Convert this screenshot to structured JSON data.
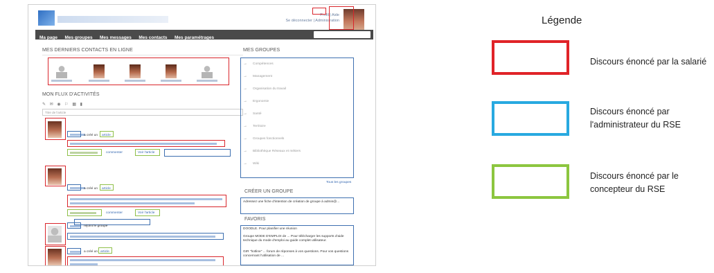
{
  "screenshot": {
    "toplinks_upper": "Profil | Aide",
    "toplinks_lower": "Se déconnecter | Administration",
    "nav": [
      "Ma page",
      "Mes groupes",
      "Mes messages",
      "Mes contacts",
      "Mes paramétrages"
    ],
    "contacts_heading": "MES DERNIERS CONTACTS EN LIGNE",
    "activity_heading": "MON FLUX D'ACTIVITÉS",
    "title_placeholder": "Titre de l'article",
    "groups_heading": "MES GROUPES",
    "groups": [
      "Compétences",
      "Management",
      "Organisation du travail",
      "Ergonomie",
      "Santé",
      "Territoire",
      "Groupes fonctionnels",
      "Bibliothèque Réseaux et métiers",
      "Wiki"
    ],
    "all_groups": "Tous les groupes",
    "create_group_heading": "CRÉER UN GROUPE",
    "create_group_text": "Adressez une fiche d'intention de création de groupe à admin@...",
    "favorites_heading": "FAVORIS",
    "fav1": "DOODLE. Pour planifier une réunion",
    "fav2": "Groupe MODE D'EMPLOI de ... Pour télécharger les supports d'aide technique du mode d'emploi au guide complet utilisateur.",
    "fav3": "GIR \"hotline\" ... forum de réponses à vos questions. Pour vos questions concernant l'utilisation de ...",
    "feed": [
      {
        "action": "a créé un",
        "link": "article",
        "comment": "commenter",
        "see": "Voir l'article"
      },
      {
        "action": "a créé un",
        "link": "article",
        "comment": "commenter",
        "see": "Voir l'article"
      },
      {
        "action": "rejoint le groupe"
      },
      {
        "action": "a créé un",
        "link": "article"
      }
    ]
  },
  "legend": {
    "title": "Légende",
    "items": [
      {
        "color": "#e02328",
        "label": "Discours énoncé par la salarié"
      },
      {
        "color": "#28a9e0",
        "label": "Discours énoncé par l'administrateur du RSE"
      },
      {
        "color": "#8cc63f",
        "label": "Discours énoncé par le concepteur du RSE"
      }
    ]
  }
}
